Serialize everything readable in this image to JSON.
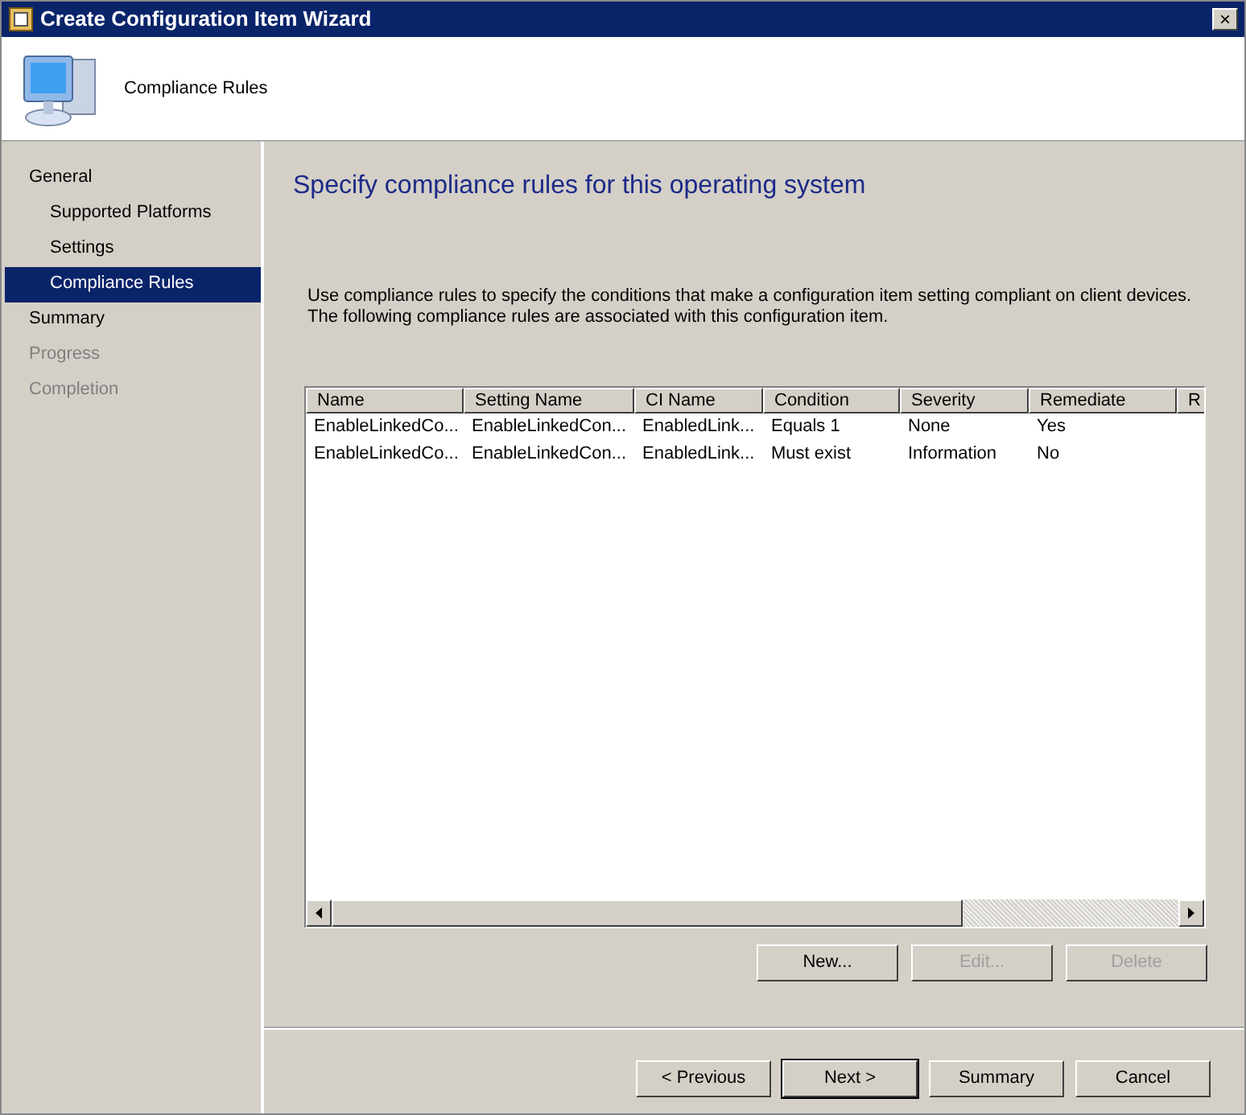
{
  "window": {
    "title": "Create Configuration Item Wizard",
    "close": "×"
  },
  "header": {
    "title": "Compliance Rules"
  },
  "steps": [
    {
      "label": "General",
      "selected": false,
      "disabled": false,
      "children": [
        {
          "label": "Supported Platforms",
          "selected": false,
          "disabled": false
        },
        {
          "label": "Settings",
          "selected": false,
          "disabled": false
        },
        {
          "label": "Compliance Rules",
          "selected": true,
          "disabled": false
        }
      ]
    },
    {
      "label": "Summary",
      "selected": false,
      "disabled": false
    },
    {
      "label": "Progress",
      "selected": false,
      "disabled": true
    },
    {
      "label": "Completion",
      "selected": false,
      "disabled": true
    }
  ],
  "page": {
    "heading": "Specify compliance rules for this operating system",
    "description": "Use compliance rules to specify the conditions that make a configuration item setting compliant on client devices. The following compliance rules are associated with this configuration item."
  },
  "table": {
    "columns": [
      "Name",
      "Setting Name",
      "CI Name",
      "Condition",
      "Severity",
      "Remediate",
      "R"
    ],
    "rows": [
      [
        "EnableLinkedCo...",
        "EnableLinkedCon...",
        "EnabledLink...",
        "Equals 1",
        "None",
        "Yes"
      ],
      [
        "EnableLinkedCo...",
        "EnableLinkedCon...",
        "EnabledLink...",
        "Must exist",
        "Information",
        "No"
      ]
    ]
  },
  "rule_buttons": [
    {
      "label": "New...",
      "disabled": false
    },
    {
      "label": "Edit...",
      "disabled": true
    },
    {
      "label": "Delete",
      "disabled": true
    }
  ],
  "nav_buttons": [
    {
      "label": "< Previous",
      "default": false
    },
    {
      "label": "Next >",
      "default": true
    },
    {
      "label": "Summary",
      "default": false
    },
    {
      "label": "Cancel",
      "default": false
    }
  ]
}
